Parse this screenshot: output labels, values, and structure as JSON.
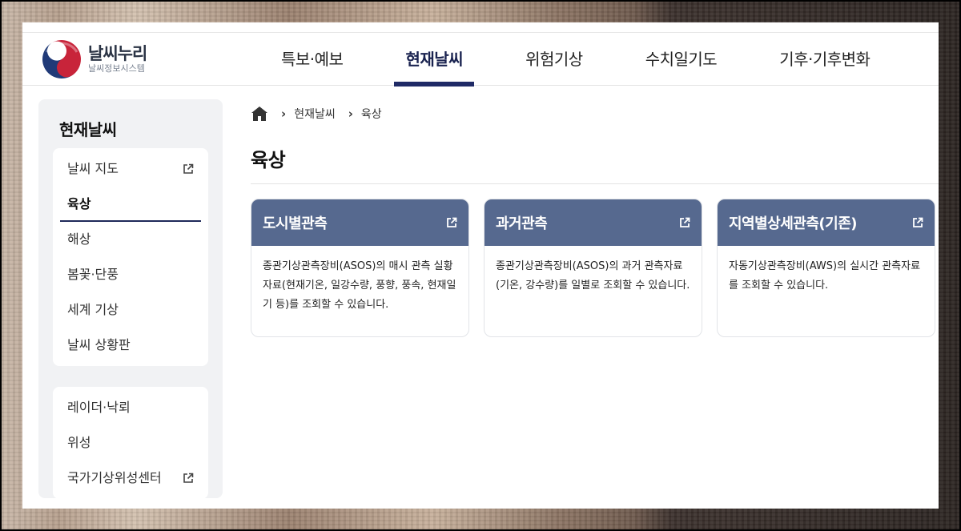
{
  "header": {
    "logo_title": "날씨누리",
    "logo_subtitle": "날씨정보시스템",
    "nav": [
      "특보·예보",
      "현재날씨",
      "위험기상",
      "수치일기도",
      "기후·기후변화"
    ],
    "active_nav_index": 1
  },
  "sidebar": {
    "title": "현재날씨",
    "group1": [
      {
        "label": "날씨 지도",
        "external": true
      },
      {
        "label": "육상",
        "external": false,
        "active": true
      },
      {
        "label": "해상",
        "external": false
      },
      {
        "label": "봄꽃·단풍",
        "external": false
      },
      {
        "label": "세계 기상",
        "external": false
      },
      {
        "label": "날씨 상황판",
        "external": false
      }
    ],
    "group2": [
      {
        "label": "레이더·낙뢰",
        "external": false
      },
      {
        "label": "위성",
        "external": false
      },
      {
        "label": "국가기상위성센터",
        "external": true
      }
    ]
  },
  "breadcrumb": [
    "현재날씨",
    "육상"
  ],
  "page_title": "육상",
  "cards": [
    {
      "title": "도시별관측",
      "description": "종관기상관측장비(ASOS)의 매시 관측 실황자료(현재기온, 일강수량, 풍향, 풍속, 현재일기 등)를 조회할 수 있습니다."
    },
    {
      "title": "과거관측",
      "description": "종관기상관측장비(ASOS)의 과거 관측자료(기온, 강수량)를 일별로 조회할 수 있습니다."
    },
    {
      "title": "지역별상세관측(기존)",
      "description": "자동기상관측장비(AWS)의 실시간 관측자료를 조회할 수 있습니다."
    }
  ],
  "colors": {
    "accent": "#1f2a66",
    "card_header": "#56698f",
    "sidebar_bg": "#f1f2f4"
  }
}
